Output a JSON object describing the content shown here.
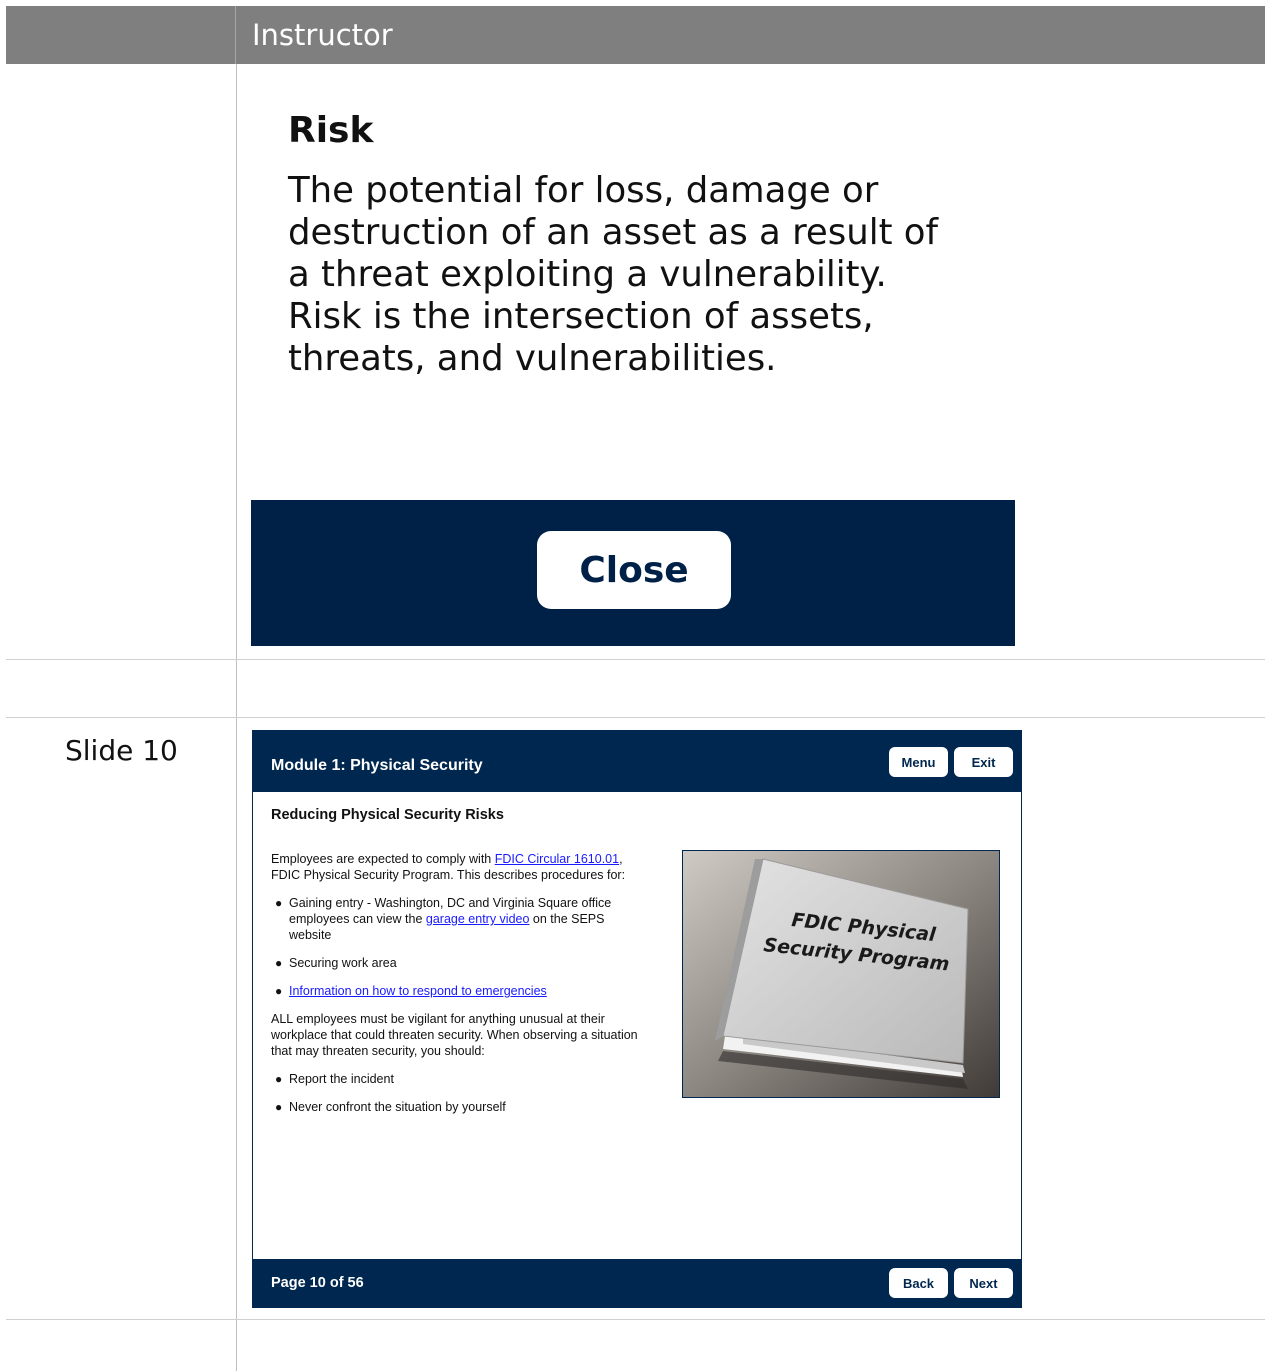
{
  "header": {
    "title": "Instructor"
  },
  "risk_popup": {
    "title": "Risk",
    "body": "The potential for loss, damage or\ndestruction of an asset as a result of\na threat exploiting a vulnerability.\nRisk is the intersection of assets,\nthreats, and vulnerabilities.",
    "close_label": "Close"
  },
  "slide_label": "Slide 10",
  "slide": {
    "module_title": "Module 1: Physical Security",
    "menu_label": "Menu",
    "exit_label": "Exit",
    "heading": "Reducing Physical Security Risks",
    "intro_pre": "Employees are expected to comply with ",
    "intro_link": "FDIC Circular 1610.01",
    "intro_post": ", FDIC Physical Security Program. This describes procedures for:",
    "bullet1_pre": "Gaining entry - Washington, DC and Virginia Square office employees can view the ",
    "bullet1_link": "garage entry video",
    "bullet1_post": " on the SEPS website",
    "bullet2": "Securing work area",
    "bullet3_link": "Information on how to respond to emergencies",
    "vigilant_text": "ALL employees must be vigilant for anything unusual at their workplace that could threaten security. When observing a situation that may threaten security, you should:",
    "bullet4": "Report the incident",
    "bullet5": "Never confront the situation by yourself",
    "image_caption_line1": "FDIC Physical",
    "image_caption_line2": "Security Program",
    "page_indicator": "Page 10 of 56",
    "back_label": "Back",
    "next_label": "Next"
  },
  "colors": {
    "header_bg": "#7f7f7f",
    "navy": "#00274f",
    "close_bar": "#002147",
    "link": "#1a1aff"
  }
}
